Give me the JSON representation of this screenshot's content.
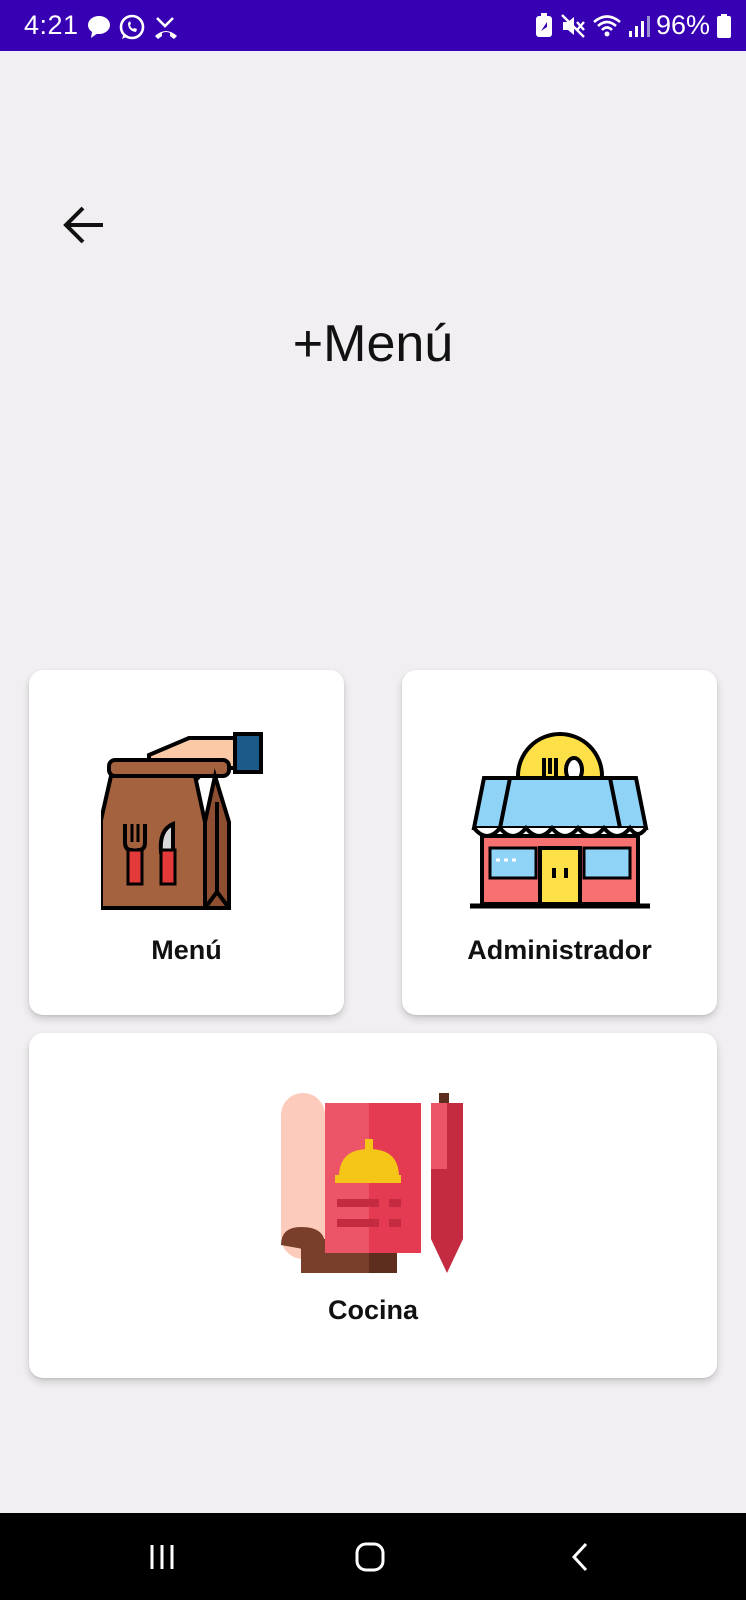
{
  "status_bar": {
    "time": "4:21",
    "battery_percent": "96%",
    "left_icons": [
      "chat-bubble-icon",
      "whatsapp-icon",
      "missed-call-icon"
    ],
    "right_icons": [
      "battery-saver-icon",
      "mute-icon",
      "wifi-icon",
      "signal-icon",
      "battery-icon"
    ],
    "background": "#3700b3"
  },
  "header": {
    "back_icon": "arrow-back-icon",
    "title": "+Menú"
  },
  "cards": {
    "menu": {
      "label": "Menú",
      "icon": "food-bag-icon"
    },
    "admin": {
      "label": "Administrador",
      "icon": "restaurant-store-icon"
    },
    "cocina": {
      "label": "Cocina",
      "icon": "recipe-menu-icon"
    }
  },
  "nav_bar": {
    "buttons": [
      "recents-icon",
      "home-icon",
      "back-icon"
    ]
  }
}
